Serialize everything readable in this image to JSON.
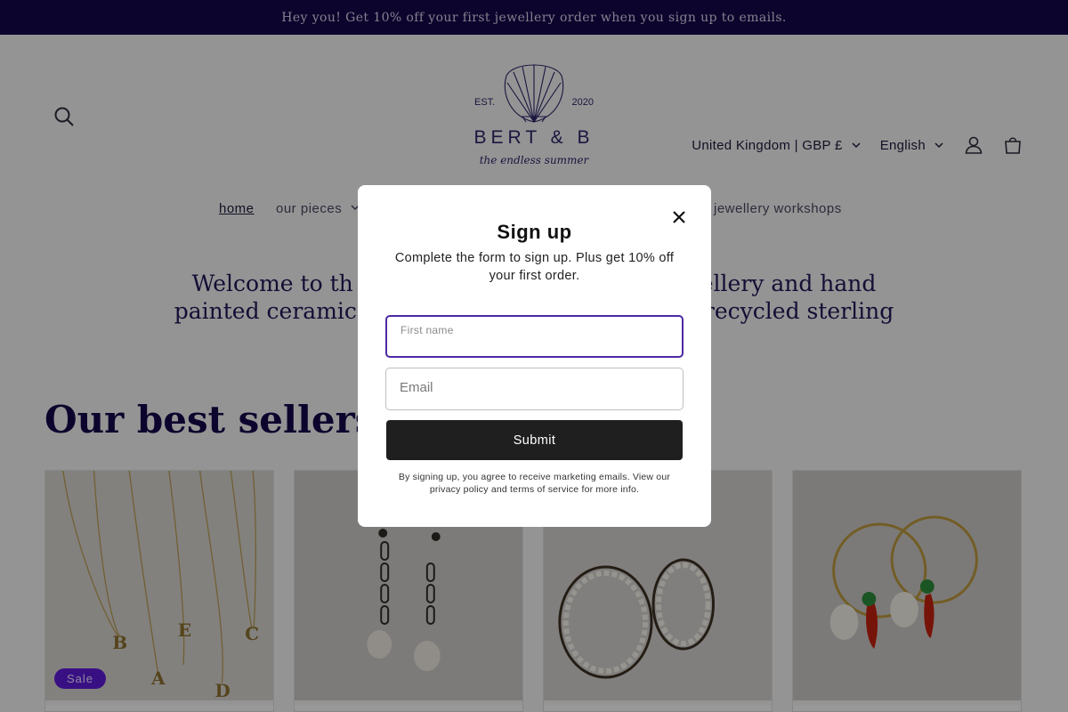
{
  "announcement": "Hey you! Get 10% off your first jewellery order when you sign up to emails.",
  "logo": {
    "est": "EST.",
    "year": "2020",
    "brand": "BERT & B",
    "tagline": "the endless summer"
  },
  "header": {
    "country_selector": "United Kingdom | GBP £",
    "language_selector": "English",
    "icons": [
      "search-icon",
      "account-icon",
      "cart-icon"
    ]
  },
  "nav": {
    "home": "home",
    "pieces": "our pieces",
    "workshops": "jewellery workshops"
  },
  "hero": {
    "line1_left": "Welcome to th",
    "line1_right": "ellery and hand",
    "line2_left": "painted ceramic",
    "line2_right": "recycled sterling"
  },
  "best_sellers": {
    "title": "Our best sellers",
    "sale_badge": "Sale"
  },
  "modal": {
    "title": "Sign up",
    "description": "Complete the form to sign up. Plus get 10% off your first order.",
    "first_name_label": "First name",
    "email_placeholder": "Email",
    "submit_label": "Submit",
    "legal": "By signing up, you agree to receive marketing emails. View our privacy policy and terms of service for more info."
  },
  "colors": {
    "announcement_bg": "#15084a",
    "accent": "#5d1ad6",
    "heading": "#15084a"
  }
}
